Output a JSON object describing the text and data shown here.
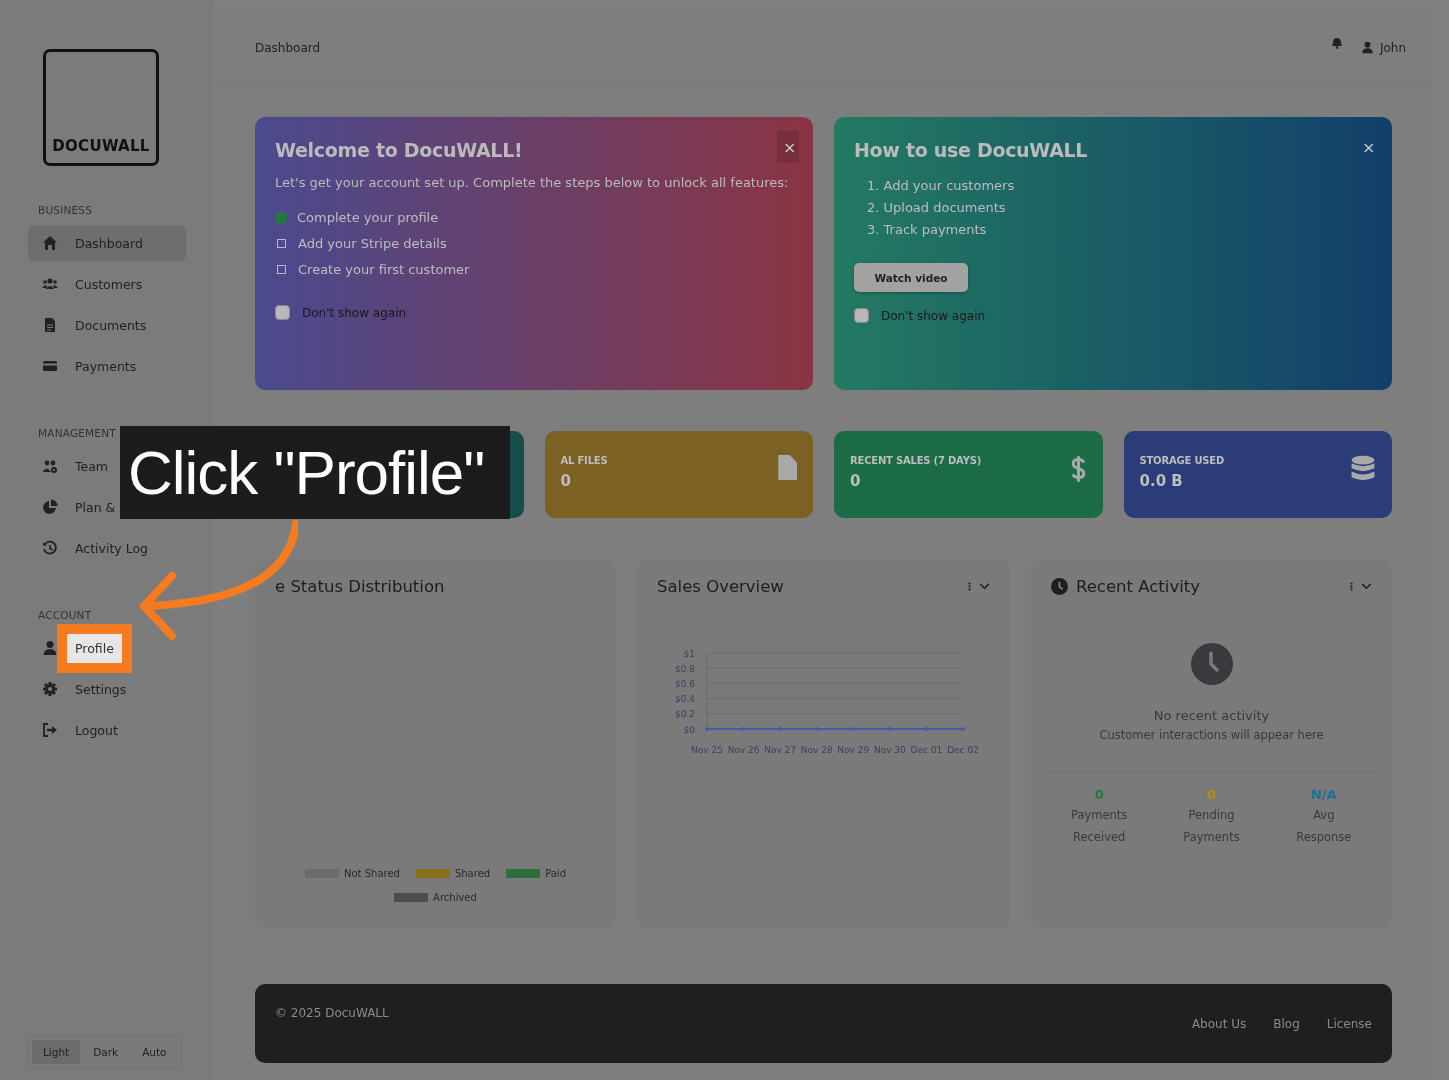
{
  "header": {
    "breadcrumb": "Dashboard",
    "user": "John"
  },
  "sidebar": {
    "logo": "DOCUWALL",
    "sections": [
      {
        "title": "BUSINESS",
        "items": [
          {
            "label": "Dashboard",
            "selected": true
          },
          {
            "label": "Customers",
            "selected": false
          },
          {
            "label": "Documents",
            "selected": false
          },
          {
            "label": "Payments",
            "selected": false
          }
        ]
      },
      {
        "title": "MANAGEMENT",
        "items": [
          {
            "label": "Team",
            "selected": false
          },
          {
            "label": "Plan &",
            "selected": false
          },
          {
            "label": "Activity Log",
            "selected": false
          }
        ]
      },
      {
        "title": "ACCOUNT",
        "items": [
          {
            "label": "Profile",
            "selected": false,
            "highlighted": true
          },
          {
            "label": "Settings",
            "selected": false
          },
          {
            "label": "Logout",
            "selected": false
          }
        ]
      }
    ],
    "theme_switch": [
      {
        "label": "Light",
        "selected": true
      },
      {
        "label": "Dark",
        "selected": false
      },
      {
        "label": "Auto",
        "selected": false
      }
    ]
  },
  "welcome": {
    "title": "Welcome to DocuWALL!",
    "intro": "Let's get your account set up. Complete the steps below to unlock all features:",
    "steps": [
      {
        "label": "Complete your profile",
        "done": true
      },
      {
        "label": "Add your Stripe details",
        "done": false
      },
      {
        "label": "Create your first customer",
        "done": false
      }
    ],
    "dont_show": {
      "label": "Don't show again",
      "checked": false
    },
    "close": "×"
  },
  "how_to": {
    "title": "How to use DocuWALL",
    "steps": [
      "1. Add your customers",
      "2. Upload documents",
      "3. Track payments"
    ],
    "button": "Watch video",
    "dont_show": {
      "label": "Don't show again",
      "checked": false
    },
    "close": "×"
  },
  "stats": [
    {
      "color": "#164e4c"
    },
    {
      "label": "AL FILES",
      "value": "0",
      "color": "#7b6224"
    },
    {
      "label": "RECENT SALES (7 DAYS)",
      "value": "0",
      "color": "#1a6b46"
    },
    {
      "label": "STORAGE USED",
      "value": "0.0 B",
      "color": "#2b3c78"
    }
  ],
  "file_status": {
    "title": "e Status Distribution",
    "legend": [
      {
        "label": "Not Shared",
        "color": "#6b6b6b"
      },
      {
        "label": "Shared",
        "color": "#86701e"
      },
      {
        "label": "Paid",
        "color": "#2c6e3c"
      },
      {
        "label": "Archived",
        "color": "#4a4e52"
      }
    ]
  },
  "sales": {
    "title": "Sales Overview",
    "chart_data": {
      "type": "line",
      "categories": [
        "Nov 25",
        "Nov 26",
        "Nov 27",
        "Nov 28",
        "Nov 29",
        "Nov 30",
        "Dec 01",
        "Dec 02"
      ],
      "series": [
        {
          "color": "#4b5aa6",
          "values": [
            0,
            0,
            0,
            0,
            0,
            0,
            0,
            0
          ]
        }
      ],
      "grid": true,
      "ylim": [
        0,
        1
      ],
      "yticks": [
        {
          "value": 0,
          "label": "$0"
        },
        {
          "value": 0.2,
          "label": "$0.2"
        },
        {
          "value": 0.4,
          "label": "$0.4"
        },
        {
          "value": 0.6,
          "label": "$0.6"
        },
        {
          "value": 0.8,
          "label": "$0.8"
        },
        {
          "value": 1,
          "label": "$1"
        }
      ]
    }
  },
  "recent": {
    "title": "Recent Activity",
    "empty_title": "No recent activity",
    "empty_text": "Customer interactions will appear here",
    "stats": [
      {
        "value": "0",
        "label": "Payments Received",
        "color": "#1f7a3c"
      },
      {
        "value": "0",
        "label": "Pending Payments",
        "color": "#b88d12"
      },
      {
        "value": "N/A",
        "label": "Avg Response",
        "color": "#1f6f95"
      }
    ]
  },
  "footer": {
    "copyright": "© 2025 DocuWALL",
    "links": [
      "About Us",
      "Blog",
      "License"
    ]
  },
  "callout": {
    "text": "Click \"Profile\""
  }
}
